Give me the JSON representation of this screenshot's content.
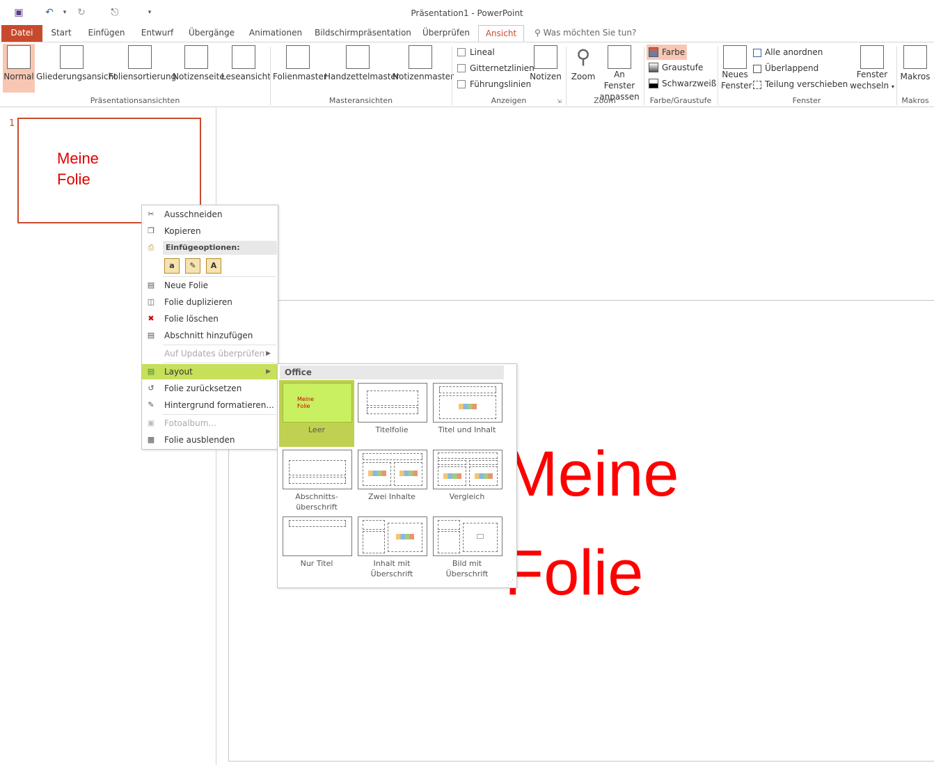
{
  "window": {
    "title": "Präsentation1 - PowerPoint"
  },
  "quick_access": [
    {
      "name": "save-icon",
      "glyph": "💾"
    },
    {
      "name": "undo-icon",
      "glyph": "↶"
    },
    {
      "name": "redo-icon",
      "glyph": "↻"
    },
    {
      "name": "present-icon",
      "glyph": "⌧"
    },
    {
      "name": "customize-icon",
      "glyph": "▾"
    }
  ],
  "tabs": [
    "Datei",
    "Start",
    "Einfügen",
    "Entwurf",
    "Übergänge",
    "Animationen",
    "Bildschirmpräsentation",
    "Überprüfen",
    "Ansicht"
  ],
  "tell_me": "Was möchten Sie tun?",
  "ribbon": {
    "groups": {
      "presentation_views": "Präsentationsansichten",
      "master_views": "Masteransichten",
      "show": "Anzeigen",
      "zoom": "Zoom",
      "color": "Farbe/Graustufe",
      "window": "Fenster",
      "macros": "Makros"
    },
    "views": [
      "Normal",
      "Gliederungsansicht",
      "Foliensortierung",
      "Notizenseite",
      "Leseansicht"
    ],
    "masters": [
      "Folienmaster",
      "Handzettelmaster",
      "Notizenmaster"
    ],
    "show_checks": [
      "Lineal",
      "Gitternetzlinien",
      "Führungslinien"
    ],
    "notes": "Notizen",
    "zoom": "Zoom",
    "fit1": "An Fenster",
    "fit2": "anpassen",
    "color_opts": [
      "Farbe",
      "Graustufe",
      "Schwarzweiß"
    ],
    "new_window1": "Neues",
    "new_window2": "Fenster",
    "window_opts": [
      "Alle anordnen",
      "Überlappend",
      "Teilung verschieben"
    ],
    "switch1": "Fenster",
    "switch2": "wechseln",
    "macros": "Makros"
  },
  "thumbnail": {
    "number": "1",
    "line1": "Meine",
    "line2": "Folie"
  },
  "slide": {
    "line1": "Meine",
    "line2": "Folie"
  },
  "context_menu": {
    "cut": "Ausschneiden",
    "copy": "Kopieren",
    "paste_options": "Einfügeoptionen:",
    "new_slide": "Neue Folie",
    "duplicate": "Folie duplizieren",
    "delete": "Folie löschen",
    "add_section": "Abschnitt hinzufügen",
    "check_updates": "Auf Updates überprüfen",
    "layout": "Layout",
    "reset": "Folie zurücksetzen",
    "format_bg": "Hintergrund formatieren...",
    "photo_album": "Fotoalbum...",
    "hide": "Folie ausblenden"
  },
  "layout_gallery": {
    "header": "Office",
    "items": [
      {
        "line1": "Leer",
        "line2": ""
      },
      {
        "line1": "Titelfolie",
        "line2": ""
      },
      {
        "line1": "Titel und Inhalt",
        "line2": ""
      },
      {
        "line1": "Abschnitts-",
        "line2": "überschrift"
      },
      {
        "line1": "Zwei Inhalte",
        "line2": ""
      },
      {
        "line1": "Vergleich",
        "line2": ""
      },
      {
        "line1": "Nur Titel",
        "line2": ""
      },
      {
        "line1": "Inhalt mit",
        "line2": "Überschrift"
      },
      {
        "line1": "Bild mit",
        "line2": "Überschrift"
      }
    ],
    "preview_text1": "Meine",
    "preview_text2": "Folie"
  },
  "colors": {
    "accent": "#c84a2c",
    "highlight": "#c6e05a",
    "slide_text": "#ff0000"
  }
}
